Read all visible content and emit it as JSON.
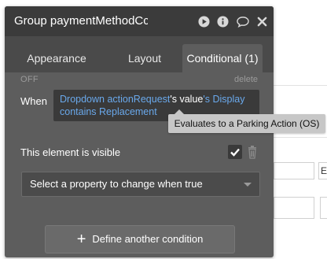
{
  "background": {
    "right_letter": "E"
  },
  "panel": {
    "title": "Group paymentMethodCc",
    "icons": [
      "play-icon",
      "info-icon",
      "comment-icon",
      "close-icon"
    ],
    "tabs": [
      {
        "label": "Appearance",
        "active": false
      },
      {
        "label": "Layout",
        "active": false
      },
      {
        "label": "Conditional (1)",
        "active": true
      }
    ],
    "condition": {
      "state_label": "OFF",
      "delete_label": "delete",
      "when_label": "When",
      "expression": {
        "part1": "Dropdown actionRequest",
        "part2": "'s value",
        "part3": "'s Display",
        "part4": "contains Replacement"
      },
      "tooltip": "Evaluates to a Parking Action (OS)",
      "property": {
        "label": "This element is visible",
        "checked": true
      },
      "select_placeholder": "Select a property to change when true"
    },
    "define_button_label": "Define another condition",
    "colors": {
      "panel_bg": "#5d5d5d",
      "titlebar_bg": "#3b3b3b",
      "link_blue": "#6aa9ec",
      "tooltip_bg": "#c7c7c7"
    }
  }
}
